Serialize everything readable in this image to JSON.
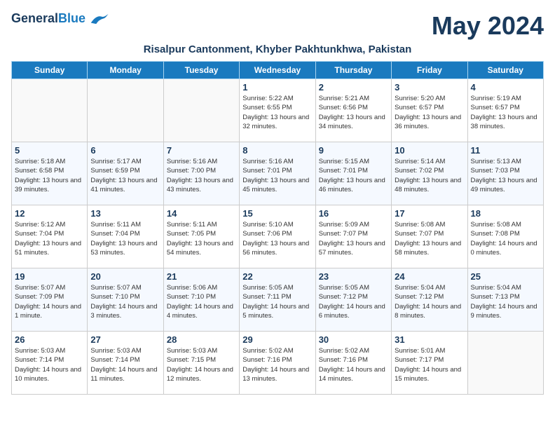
{
  "logo": {
    "general": "General",
    "blue": "Blue"
  },
  "title": "May 2024",
  "subtitle": "Risalpur Cantonment, Khyber Pakhtunkhwa, Pakistan",
  "weekdays": [
    "Sunday",
    "Monday",
    "Tuesday",
    "Wednesday",
    "Thursday",
    "Friday",
    "Saturday"
  ],
  "weeks": [
    [
      {
        "day": "",
        "sunrise": "",
        "sunset": "",
        "daylight": ""
      },
      {
        "day": "",
        "sunrise": "",
        "sunset": "",
        "daylight": ""
      },
      {
        "day": "",
        "sunrise": "",
        "sunset": "",
        "daylight": ""
      },
      {
        "day": "1",
        "sunrise": "Sunrise: 5:22 AM",
        "sunset": "Sunset: 6:55 PM",
        "daylight": "Daylight: 13 hours and 32 minutes."
      },
      {
        "day": "2",
        "sunrise": "Sunrise: 5:21 AM",
        "sunset": "Sunset: 6:56 PM",
        "daylight": "Daylight: 13 hours and 34 minutes."
      },
      {
        "day": "3",
        "sunrise": "Sunrise: 5:20 AM",
        "sunset": "Sunset: 6:57 PM",
        "daylight": "Daylight: 13 hours and 36 minutes."
      },
      {
        "day": "4",
        "sunrise": "Sunrise: 5:19 AM",
        "sunset": "Sunset: 6:57 PM",
        "daylight": "Daylight: 13 hours and 38 minutes."
      }
    ],
    [
      {
        "day": "5",
        "sunrise": "Sunrise: 5:18 AM",
        "sunset": "Sunset: 6:58 PM",
        "daylight": "Daylight: 13 hours and 39 minutes."
      },
      {
        "day": "6",
        "sunrise": "Sunrise: 5:17 AM",
        "sunset": "Sunset: 6:59 PM",
        "daylight": "Daylight: 13 hours and 41 minutes."
      },
      {
        "day": "7",
        "sunrise": "Sunrise: 5:16 AM",
        "sunset": "Sunset: 7:00 PM",
        "daylight": "Daylight: 13 hours and 43 minutes."
      },
      {
        "day": "8",
        "sunrise": "Sunrise: 5:16 AM",
        "sunset": "Sunset: 7:01 PM",
        "daylight": "Daylight: 13 hours and 45 minutes."
      },
      {
        "day": "9",
        "sunrise": "Sunrise: 5:15 AM",
        "sunset": "Sunset: 7:01 PM",
        "daylight": "Daylight: 13 hours and 46 minutes."
      },
      {
        "day": "10",
        "sunrise": "Sunrise: 5:14 AM",
        "sunset": "Sunset: 7:02 PM",
        "daylight": "Daylight: 13 hours and 48 minutes."
      },
      {
        "day": "11",
        "sunrise": "Sunrise: 5:13 AM",
        "sunset": "Sunset: 7:03 PM",
        "daylight": "Daylight: 13 hours and 49 minutes."
      }
    ],
    [
      {
        "day": "12",
        "sunrise": "Sunrise: 5:12 AM",
        "sunset": "Sunset: 7:04 PM",
        "daylight": "Daylight: 13 hours and 51 minutes."
      },
      {
        "day": "13",
        "sunrise": "Sunrise: 5:11 AM",
        "sunset": "Sunset: 7:04 PM",
        "daylight": "Daylight: 13 hours and 53 minutes."
      },
      {
        "day": "14",
        "sunrise": "Sunrise: 5:11 AM",
        "sunset": "Sunset: 7:05 PM",
        "daylight": "Daylight: 13 hours and 54 minutes."
      },
      {
        "day": "15",
        "sunrise": "Sunrise: 5:10 AM",
        "sunset": "Sunset: 7:06 PM",
        "daylight": "Daylight: 13 hours and 56 minutes."
      },
      {
        "day": "16",
        "sunrise": "Sunrise: 5:09 AM",
        "sunset": "Sunset: 7:07 PM",
        "daylight": "Daylight: 13 hours and 57 minutes."
      },
      {
        "day": "17",
        "sunrise": "Sunrise: 5:08 AM",
        "sunset": "Sunset: 7:07 PM",
        "daylight": "Daylight: 13 hours and 58 minutes."
      },
      {
        "day": "18",
        "sunrise": "Sunrise: 5:08 AM",
        "sunset": "Sunset: 7:08 PM",
        "daylight": "Daylight: 14 hours and 0 minutes."
      }
    ],
    [
      {
        "day": "19",
        "sunrise": "Sunrise: 5:07 AM",
        "sunset": "Sunset: 7:09 PM",
        "daylight": "Daylight: 14 hours and 1 minute."
      },
      {
        "day": "20",
        "sunrise": "Sunrise: 5:07 AM",
        "sunset": "Sunset: 7:10 PM",
        "daylight": "Daylight: 14 hours and 3 minutes."
      },
      {
        "day": "21",
        "sunrise": "Sunrise: 5:06 AM",
        "sunset": "Sunset: 7:10 PM",
        "daylight": "Daylight: 14 hours and 4 minutes."
      },
      {
        "day": "22",
        "sunrise": "Sunrise: 5:05 AM",
        "sunset": "Sunset: 7:11 PM",
        "daylight": "Daylight: 14 hours and 5 minutes."
      },
      {
        "day": "23",
        "sunrise": "Sunrise: 5:05 AM",
        "sunset": "Sunset: 7:12 PM",
        "daylight": "Daylight: 14 hours and 6 minutes."
      },
      {
        "day": "24",
        "sunrise": "Sunrise: 5:04 AM",
        "sunset": "Sunset: 7:12 PM",
        "daylight": "Daylight: 14 hours and 8 minutes."
      },
      {
        "day": "25",
        "sunrise": "Sunrise: 5:04 AM",
        "sunset": "Sunset: 7:13 PM",
        "daylight": "Daylight: 14 hours and 9 minutes."
      }
    ],
    [
      {
        "day": "26",
        "sunrise": "Sunrise: 5:03 AM",
        "sunset": "Sunset: 7:14 PM",
        "daylight": "Daylight: 14 hours and 10 minutes."
      },
      {
        "day": "27",
        "sunrise": "Sunrise: 5:03 AM",
        "sunset": "Sunset: 7:14 PM",
        "daylight": "Daylight: 14 hours and 11 minutes."
      },
      {
        "day": "28",
        "sunrise": "Sunrise: 5:03 AM",
        "sunset": "Sunset: 7:15 PM",
        "daylight": "Daylight: 14 hours and 12 minutes."
      },
      {
        "day": "29",
        "sunrise": "Sunrise: 5:02 AM",
        "sunset": "Sunset: 7:16 PM",
        "daylight": "Daylight: 14 hours and 13 minutes."
      },
      {
        "day": "30",
        "sunrise": "Sunrise: 5:02 AM",
        "sunset": "Sunset: 7:16 PM",
        "daylight": "Daylight: 14 hours and 14 minutes."
      },
      {
        "day": "31",
        "sunrise": "Sunrise: 5:01 AM",
        "sunset": "Sunset: 7:17 PM",
        "daylight": "Daylight: 14 hours and 15 minutes."
      },
      {
        "day": "",
        "sunrise": "",
        "sunset": "",
        "daylight": ""
      }
    ]
  ]
}
